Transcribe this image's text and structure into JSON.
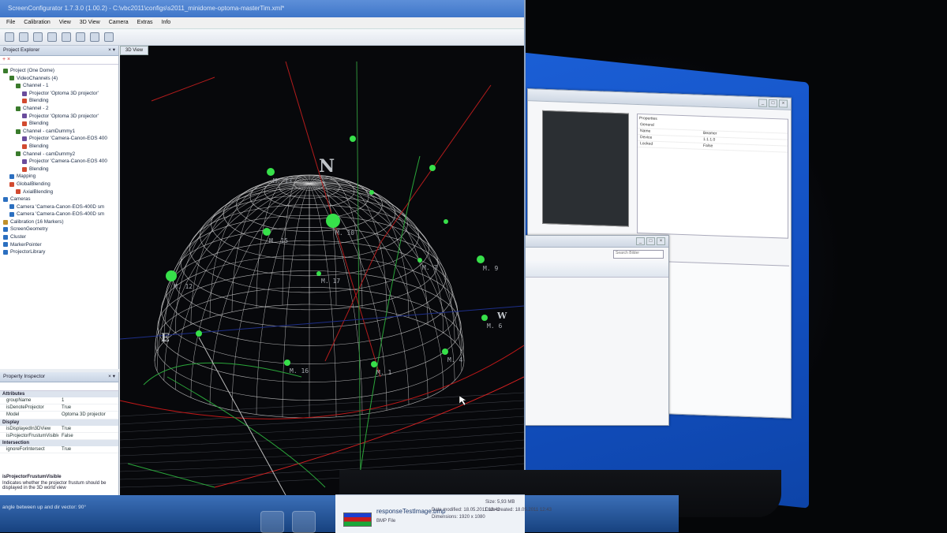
{
  "app": {
    "title": "ScreenConfigurator 1.7.3.0 (1.00.2) - C:\\vbc2011\\configs\\s2011_minidome-optoma-masterTim.xml*",
    "menu": [
      "File",
      "Calibration",
      "View",
      "3D View",
      "Camera",
      "Extras",
      "Info"
    ],
    "colors": {
      "accent": "#3f76c9",
      "desktop": "#124fc0",
      "viewport": "#07080b",
      "dome": "#d8d8d8",
      "marker": "#37e04a"
    }
  },
  "explorer": {
    "title": "Project Explorer",
    "items": [
      {
        "label": "Project (One Dome)",
        "level": 0,
        "icon": "project-icon"
      },
      {
        "label": "VideoChannels (4)",
        "level": 1,
        "icon": "folder-icon"
      },
      {
        "label": "Channel - 1",
        "level": 2,
        "icon": "channel-icon"
      },
      {
        "label": "Projector 'Optoma 3D projector'",
        "level": 3,
        "icon": "projector-icon"
      },
      {
        "label": "Blending",
        "level": 3,
        "icon": "blending-icon"
      },
      {
        "label": "Channel - 2",
        "level": 2,
        "icon": "channel-icon"
      },
      {
        "label": "Projector 'Optoma 3D projector'",
        "level": 3,
        "icon": "projector-icon"
      },
      {
        "label": "Blending",
        "level": 3,
        "icon": "blending-icon"
      },
      {
        "label": "Channel - camDummy1",
        "level": 2,
        "icon": "channel-icon"
      },
      {
        "label": "Projector 'Camera-Canon-EOS 400",
        "level": 3,
        "icon": "projector-icon"
      },
      {
        "label": "Blending",
        "level": 3,
        "icon": "blending-icon"
      },
      {
        "label": "Channel - camDummy2",
        "level": 2,
        "icon": "channel-icon"
      },
      {
        "label": "Projector 'Camera-Canon-EOS 400",
        "level": 3,
        "icon": "projector-icon"
      },
      {
        "label": "Blending",
        "level": 3,
        "icon": "blending-icon"
      },
      {
        "label": "Mapping",
        "level": 1,
        "icon": "mapping-icon"
      },
      {
        "label": "GlobalBlending",
        "level": 1,
        "icon": "blending-icon"
      },
      {
        "label": "AxialBlending",
        "level": 2,
        "icon": "blending-icon"
      },
      {
        "label": "Cameras",
        "level": 0,
        "icon": "camera-icon"
      },
      {
        "label": "Camera 'Camera-Canon-EOS-400D sm",
        "level": 1,
        "icon": "camera-icon"
      },
      {
        "label": "Camera 'Camera-Canon-EOS-400D sm",
        "level": 1,
        "icon": "camera-icon"
      },
      {
        "label": "Calibration (16 Markers)",
        "level": 0,
        "icon": "calibration-icon"
      },
      {
        "label": "ScreenGeometry",
        "level": 0,
        "icon": "geometry-icon"
      },
      {
        "label": "Cluster",
        "level": 0,
        "icon": "cluster-icon"
      },
      {
        "label": "MarkerPointer",
        "level": 0,
        "icon": "marker-icon"
      },
      {
        "label": "ProjectorLibrary",
        "level": 0,
        "icon": "library-icon"
      }
    ]
  },
  "inspector": {
    "title": "Property Inspector",
    "sections": [
      {
        "name": "Attributes",
        "rows": [
          {
            "k": "groupName",
            "v": "1"
          },
          {
            "k": "isDenoteProjector",
            "v": "True"
          },
          {
            "k": "Model",
            "v": "Optoma 3D projector"
          }
        ]
      },
      {
        "name": "Display",
        "rows": [
          {
            "k": "isDisplayedIn3DView",
            "v": "True"
          },
          {
            "k": "isProjectorFrustumVisible",
            "v": "False"
          }
        ]
      },
      {
        "name": "Intersection",
        "rows": [
          {
            "k": "ignoreForIntersect",
            "v": "True"
          }
        ]
      }
    ],
    "desc_title": "isProjectorFrustumVisible",
    "desc_text": "Indicates whether the projector frustum should be displayed in the 3D world view",
    "status": "angle between up and dir vector: 90°"
  },
  "view3d": {
    "tab": "3D View",
    "compass": {
      "north": "N",
      "east": "E",
      "west": "W"
    },
    "markers": [
      {
        "id": "M. 12"
      },
      {
        "id": "M. 10"
      },
      {
        "id": "M. 15"
      },
      {
        "id": "M. 16"
      },
      {
        "id": "M. 1"
      },
      {
        "id": "M. 4"
      },
      {
        "id": "M. 6"
      },
      {
        "id": "M. 9"
      },
      {
        "id": "M. 13"
      },
      {
        "id": "M. 17"
      },
      {
        "id": "M. 7"
      }
    ]
  },
  "right_windows": {
    "props_title": "Properties",
    "props_rows": [
      {
        "k": "General",
        "v": ""
      },
      {
        "k": "Name",
        "v": "Beamer"
      },
      {
        "k": "Device",
        "v": "1.1.1.0"
      },
      {
        "k": "Locked",
        "v": "False"
      }
    ],
    "search_placeholder": "Search Bilder"
  },
  "file": {
    "name": "responseTestImage.bmp",
    "type": "BMP File",
    "modified_label": "Date modified: 18.05.2011 12:42",
    "dims_label": "Dimensions: 1920 x 1080",
    "size_label": "Size: 5,93 MB",
    "created_label": "Date created: 18.05.2011 12:43"
  }
}
